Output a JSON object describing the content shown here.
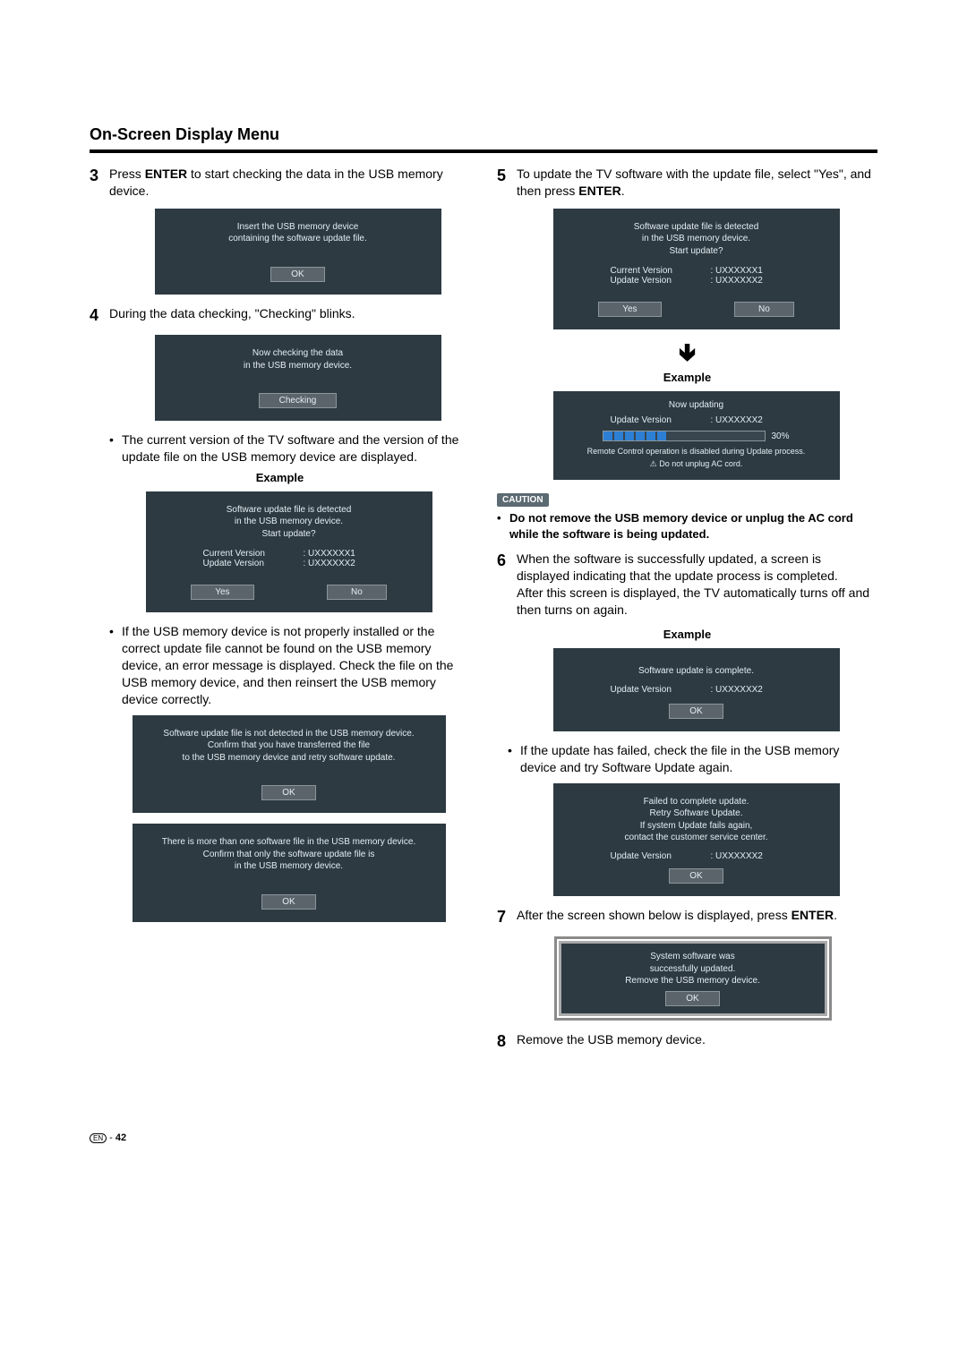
{
  "title": "On-Screen Display Menu",
  "left": {
    "step3": {
      "num": "3",
      "pre": "Press ",
      "bold": "ENTER",
      "post": " to start checking the data in the USB memory device."
    },
    "panel3": {
      "line1": "Insert the USB memory device",
      "line2": "containing the software update file.",
      "ok": "OK"
    },
    "step4": {
      "num": "4",
      "text": "During the data checking, \"Checking\" blinks."
    },
    "panel4": {
      "line1": "Now checking the data",
      "line2": "in the USB memory device.",
      "btn": "Checking"
    },
    "bullet1": "The current version of the TV software and the version of the update file on the USB memory device are displayed.",
    "exampleLabel": "Example",
    "panelDetect": {
      "l1": "Software update file is detected",
      "l2": "in the USB memory device.",
      "l3": "Start update?",
      "curLabel": "Current Version",
      "curVal": ":  UXXXXXX1",
      "updLabel": "Update Version",
      "updVal": ":  UXXXXXX2",
      "yes": "Yes",
      "no": "No"
    },
    "bullet2": "If the USB memory device is not properly installed or the correct update file cannot be found on the USB memory device, an error message is displayed. Check the file on the USB memory device, and then reinsert the USB memory device correctly.",
    "panelErr1": {
      "l1": "Software update file is not detected in the USB memory device.",
      "l2": "Confirm that you have transferred the file",
      "l3": "to the USB memory device and retry software update.",
      "ok": "OK"
    },
    "panelErr2": {
      "l1": "There is more than one software file in the USB memory device.",
      "l2": "Confirm that only the software update file is",
      "l3": "in the USB memory device.",
      "ok": "OK"
    }
  },
  "right": {
    "step5": {
      "num": "5",
      "pre": "To update the TV software with the update file, select \"Yes\", and then press ",
      "bold": "ENTER",
      "post": "."
    },
    "panel5": {
      "l1": "Software update file is detected",
      "l2": "in the USB memory device.",
      "l3": "Start update?",
      "curLabel": "Current Version",
      "curVal": ":  UXXXXXX1",
      "updLabel": "Update Version",
      "updVal": ":  UXXXXXX2",
      "yes": "Yes",
      "no": "No"
    },
    "exampleLabel": "Example",
    "progress": {
      "title": "Now updating",
      "updLabel": "Update Version",
      "updVal": ":  UXXXXXX2",
      "pct": "30%",
      "note1": "Remote Control operation is disabled during Update process.",
      "note2Icon": "⚠",
      "note2": "Do not unplug AC cord."
    },
    "cautionTag": "CAUTION",
    "caution": "Do not remove the USB memory device or unplug the AC cord while the software is being updated.",
    "step6": {
      "num": "6",
      "t1": "When the software is successfully updated, a screen is displayed indicating that the update process is completed.",
      "t2": "After this screen is displayed, the TV automatically turns off and then turns on again."
    },
    "panelComplete": {
      "l1": "Software update is complete.",
      "updLabel": "Update Version",
      "updVal": ":  UXXXXXX2",
      "ok": "OK"
    },
    "bulletFail": "If the update has failed, check the file in the USB memory device and try Software Update again.",
    "panelFail": {
      "l1": "Failed to complete update.",
      "l2": "Retry Software Update.",
      "l3": "If system Update fails again,",
      "l4": "contact the customer service center.",
      "updLabel": "Update Version",
      "updVal": ":  UXXXXXX2",
      "ok": "OK"
    },
    "step7": {
      "num": "7",
      "pre": "After the screen shown below is displayed, press ",
      "bold": "ENTER",
      "post": "."
    },
    "panelSuccess": {
      "l1": "System software was",
      "l2": "successfully updated.",
      "l3": "Remove the USB memory device.",
      "ok": "OK"
    },
    "step8": {
      "num": "8",
      "text": "Remove the USB memory device."
    }
  },
  "footer": {
    "en": "EN",
    "dash": " - ",
    "page": "42"
  }
}
